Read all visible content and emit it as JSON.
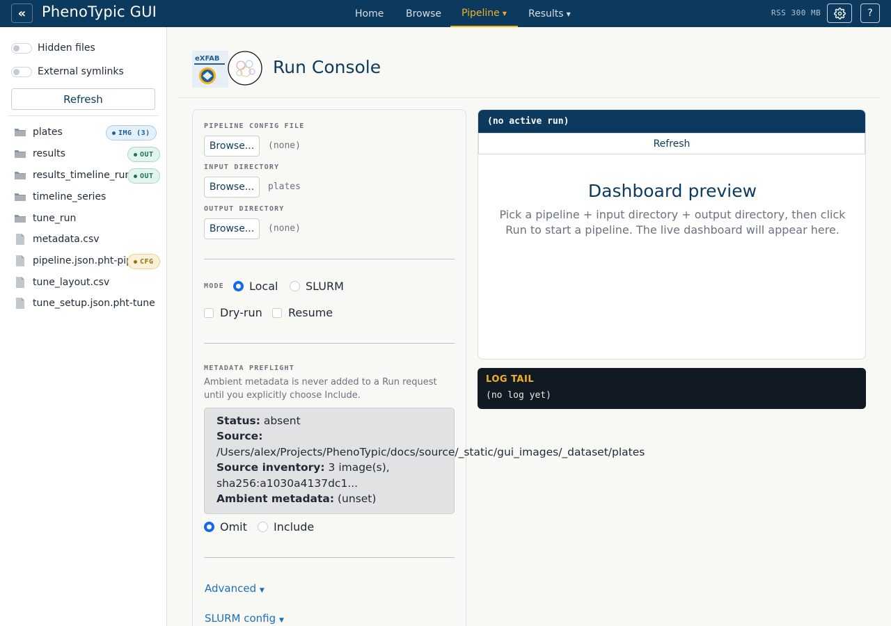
{
  "app": {
    "title": "PhenoTypic GUI",
    "collapse_glyph": "«",
    "rss": "RSS 300 MB",
    "help_label": "?"
  },
  "nav": {
    "home": "Home",
    "browse": "Browse",
    "pipeline": "Pipeline",
    "results": "Results",
    "active": "Pipeline"
  },
  "sidebar": {
    "hidden_files_label": "Hidden files",
    "external_symlinks_label": "External symlinks",
    "refresh_label": "Refresh",
    "items": [
      {
        "name": "plates",
        "kind": "folder",
        "badge": "IMG (3)",
        "badge_type": "img"
      },
      {
        "name": "results",
        "kind": "folder",
        "badge": "OUT",
        "badge_type": "out"
      },
      {
        "name": "results_timeline_run",
        "kind": "folder",
        "badge": "OUT",
        "badge_type": "out"
      },
      {
        "name": "timeline_series",
        "kind": "folder"
      },
      {
        "name": "tune_run",
        "kind": "folder"
      },
      {
        "name": "metadata.csv",
        "kind": "file"
      },
      {
        "name": "pipeline.json.pht-pipe",
        "kind": "file",
        "badge": "CFG",
        "badge_type": "cfg"
      },
      {
        "name": "tune_layout.csv",
        "kind": "file"
      },
      {
        "name": "tune_setup.json.pht-tune",
        "kind": "file"
      }
    ]
  },
  "page": {
    "title": "Run Console",
    "logo_text": "eXFAB"
  },
  "form": {
    "pipeline_config_label": "PIPELINE CONFIG FILE",
    "pipeline_config_value": "(none)",
    "input_dir_label": "INPUT DIRECTORY",
    "input_dir_value": "plates",
    "output_dir_label": "OUTPUT DIRECTORY",
    "output_dir_value": "(none)",
    "browse_label": "Browse...",
    "mode_label": "MODE",
    "mode_local": "Local",
    "mode_slurm": "SLURM",
    "mode_selected": "Local",
    "dry_run_label": "Dry-run",
    "resume_label": "Resume",
    "metadata_label": "METADATA PREFLIGHT",
    "metadata_desc": "Ambient metadata is never added to a Run request until you explicitly choose Include.",
    "status_key": "Status:",
    "status_val": "absent",
    "source_key": "Source:",
    "source_val": "/Users/alex/Projects/PhenoTypic/docs/source/_static/gui_images/_dataset/plates",
    "inventory_key": "Source inventory:",
    "inventory_val": "3 image(s),",
    "inventory_hash": "sha256:a1030a4137dc1...",
    "ambient_key": "Ambient metadata:",
    "ambient_val": "(unset)",
    "omit_label": "Omit",
    "include_label": "Include",
    "metadata_selected": "Omit",
    "advanced_label": "Advanced",
    "slurm_config_label": "SLURM config"
  },
  "run": {
    "status": "(no active run)",
    "refresh_label": "Refresh",
    "dashboard_title": "Dashboard preview",
    "dashboard_desc": "Pick a pipeline + input directory + output directory, then click Run to start a pipeline. The live dashboard will appear here."
  },
  "log": {
    "title": "LOG TAIL",
    "body": "(no log yet)"
  },
  "colors": {
    "navy": "#0b3a5e",
    "accent": "#f3b21b",
    "radio_on": "#1769e8",
    "link": "#1d6fb8"
  }
}
